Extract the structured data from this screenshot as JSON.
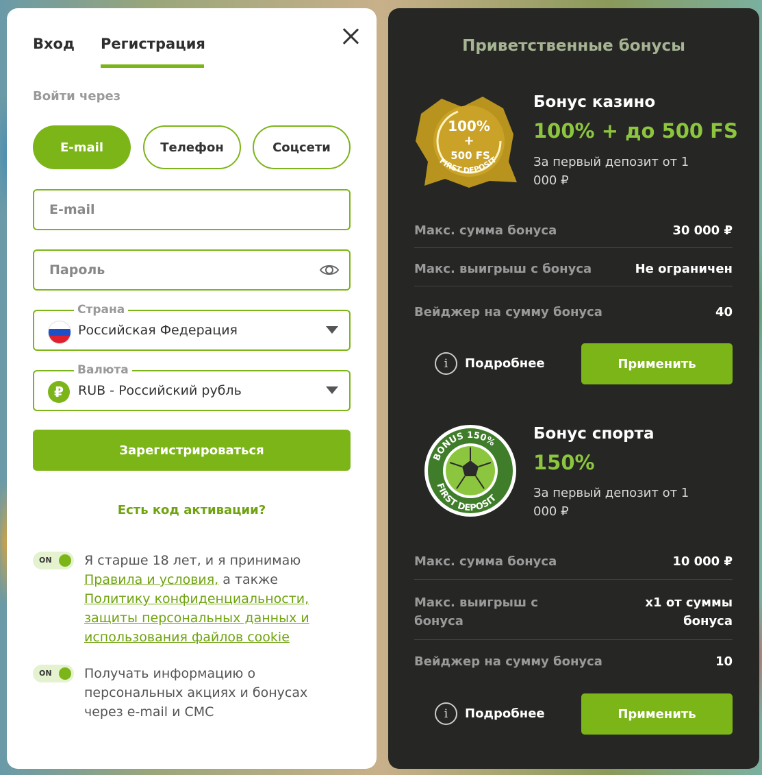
{
  "auth": {
    "tabs": {
      "login": "Вход",
      "register": "Регистрация"
    },
    "via_label": "Войти через",
    "methods": {
      "email": "E-mail",
      "phone": "Телефон",
      "social": "Соцсети"
    },
    "email_placeholder": "E-mail",
    "password_placeholder": "Пароль",
    "country": {
      "legend": "Страна",
      "value": "Российская Федерация"
    },
    "currency": {
      "legend": "Валюта",
      "symbol": "₽",
      "value": "RUB - Российский рубль"
    },
    "register_button": "Зарегистрироваться",
    "activation_link": "Есть код активации?",
    "toggle_label": "ON",
    "consent_age": {
      "prefix": "Я старше 18 лет, и я принимаю",
      "rules_link": "Правила и условия,",
      "middle": " а также",
      "policy_link": "Политику конфиденциальности, защиты персональных данных и использования файлов cookie"
    },
    "consent_promo": "Получать информацию о персональных акциях и бонусах через e-mail и СМС"
  },
  "bonuses": {
    "title": "Приветственные бонусы",
    "casino": {
      "badge": {
        "line1": "100%",
        "line2": "+",
        "line3": "500 FS",
        "arc": "FIRST DEPOSIT"
      },
      "name": "Бонус казино",
      "amount": "100% + до 500 FS",
      "condition": "За первый депозит от 1 000 ₽",
      "rows": [
        {
          "label": "Макс. сумма бонуса",
          "value": "30 000 ₽"
        },
        {
          "label": "Макс. выигрыш с бонуса",
          "value": "Не ограничен"
        },
        {
          "label": "Вейджер на сумму бонуса",
          "value": "40"
        }
      ],
      "details": "Подробнее",
      "apply": "Применить"
    },
    "sport": {
      "badge": {
        "arc_top": "BONUS 150%",
        "arc_bottom": "FIRST DEPOSIT"
      },
      "name": "Бонус спорта",
      "amount": "150%",
      "condition": "За первый депозит от 1 000 ₽",
      "rows": [
        {
          "label": "Макс. сумма бонуса",
          "value": "10 000 ₽"
        },
        {
          "label": "Макс. выигрыш с бонуса",
          "value": "x1 от суммы бонуса"
        },
        {
          "label": "Вейджер на сумму бонуса",
          "value": "10"
        }
      ],
      "details": "Подробнее",
      "apply": "Применить"
    }
  },
  "colors": {
    "accent": "#7cb518",
    "dark_panel": "#262624",
    "bonus_amount": "#8cc63f"
  },
  "icons": [
    "close-icon",
    "eye-icon",
    "russia-flag-icon",
    "ruble-icon",
    "info-icon"
  ]
}
